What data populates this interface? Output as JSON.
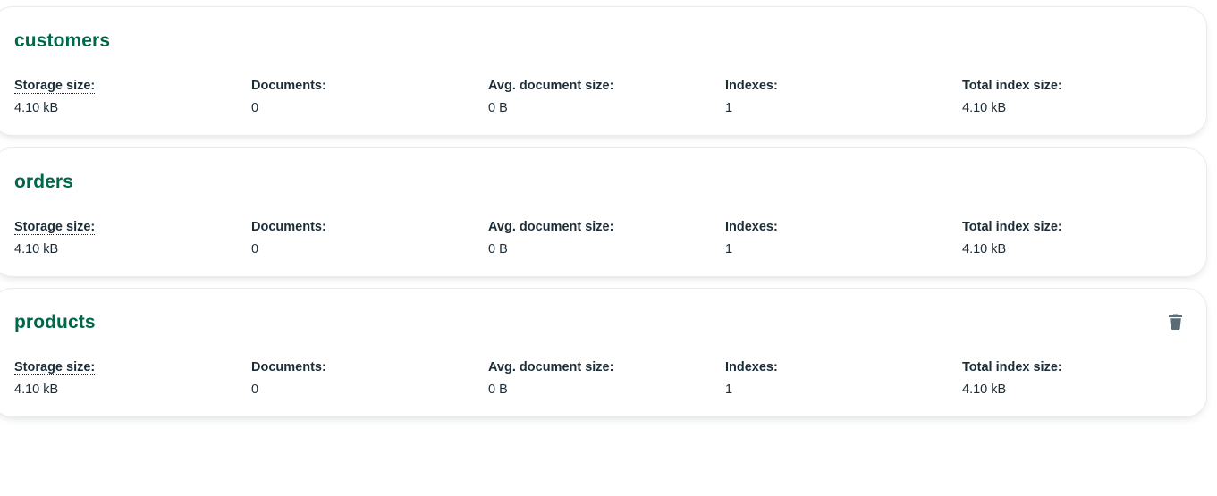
{
  "collections": [
    {
      "name": "customers",
      "stats": {
        "storage_size_label": "Storage size:",
        "storage_size": "4.10 kB",
        "documents_label": "Documents:",
        "documents": "0",
        "avg_doc_size_label": "Avg. document size:",
        "avg_doc_size": "0 B",
        "indexes_label": "Indexes:",
        "indexes": "1",
        "total_index_size_label": "Total index size:",
        "total_index_size": "4.10 kB"
      }
    },
    {
      "name": "orders",
      "stats": {
        "storage_size_label": "Storage size:",
        "storage_size": "4.10 kB",
        "documents_label": "Documents:",
        "documents": "0",
        "avg_doc_size_label": "Avg. document size:",
        "avg_doc_size": "0 B",
        "indexes_label": "Indexes:",
        "indexes": "1",
        "total_index_size_label": "Total index size:",
        "total_index_size": "4.10 kB"
      }
    },
    {
      "name": "products",
      "stats": {
        "storage_size_label": "Storage size:",
        "storage_size": "4.10 kB",
        "documents_label": "Documents:",
        "documents": "0",
        "avg_doc_size_label": "Avg. document size:",
        "avg_doc_size": "0 B",
        "indexes_label": "Indexes:",
        "indexes": "1",
        "total_index_size_label": "Total index size:",
        "total_index_size": "4.10 kB"
      },
      "delete_icon": "trash-icon"
    }
  ],
  "colors": {
    "title": "#00684a",
    "text": "#1c2d38",
    "icon": "#5c6c75"
  }
}
